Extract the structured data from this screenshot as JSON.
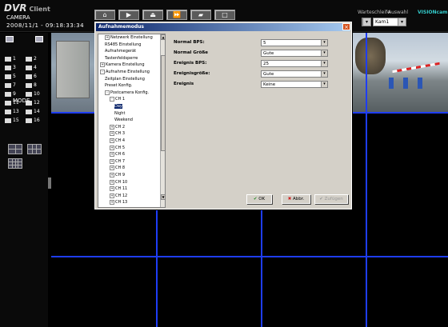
{
  "app": {
    "logo_main": "DVR",
    "logo_sub": "Client",
    "datetime": "2008/11/1 - 09:18:33:34"
  },
  "toolbar": {
    "buttons": [
      "⌂",
      "▶",
      "⏏",
      "⏩",
      "▰",
      "□"
    ]
  },
  "header": {
    "label1": "Warteschleife",
    "label2": "Auswahl",
    "brand": "VISIONcam",
    "select1": "",
    "select2": "Kam1"
  },
  "leftpanel": {
    "camera_label": "CAMERA",
    "mode_label": "MODE",
    "cameras": [
      "1",
      "2",
      "3",
      "4",
      "5",
      "6",
      "7",
      "8",
      "9",
      "10",
      "11",
      "12",
      "13",
      "14",
      "15",
      "16"
    ]
  },
  "dialog": {
    "title": "Aufnahmemodus",
    "close": "×",
    "tree": [
      {
        "label": "Netzwerk Einstellung",
        "level": 1,
        "pm": "+"
      },
      {
        "label": "RS485 Einstellung",
        "level": 1,
        "pm": ""
      },
      {
        "label": "Aufnahmegerät",
        "level": 1,
        "pm": ""
      },
      {
        "label": "Tastenfeldsperre",
        "level": 1,
        "pm": ""
      },
      {
        "label": "Kamera Einstellung",
        "level": 0,
        "pm": "+"
      },
      {
        "label": "Aufnahme Einstellung",
        "level": 0,
        "pm": "-"
      },
      {
        "label": "Zeitplan Einstellung",
        "level": 1,
        "pm": ""
      },
      {
        "label": "Preset Konfig.",
        "level": 1,
        "pm": ""
      },
      {
        "label": "Postcamera Konfig.",
        "level": 1,
        "pm": "-"
      },
      {
        "label": "CH 1",
        "level": 2,
        "pm": "-"
      },
      {
        "label": "Day",
        "level": 3,
        "pm": "",
        "selected": true
      },
      {
        "label": "Night",
        "level": 3,
        "pm": ""
      },
      {
        "label": "Weekend",
        "level": 3,
        "pm": ""
      },
      {
        "label": "CH 2",
        "level": 2,
        "pm": "+"
      },
      {
        "label": "CH 3",
        "level": 2,
        "pm": "+"
      },
      {
        "label": "CH 4",
        "level": 2,
        "pm": "+"
      },
      {
        "label": "CH 5",
        "level": 2,
        "pm": "+"
      },
      {
        "label": "CH 6",
        "level": 2,
        "pm": "+"
      },
      {
        "label": "CH 7",
        "level": 2,
        "pm": "+"
      },
      {
        "label": "CH 8",
        "level": 2,
        "pm": "+"
      },
      {
        "label": "CH 9",
        "level": 2,
        "pm": "+"
      },
      {
        "label": "CH 10",
        "level": 2,
        "pm": "+"
      },
      {
        "label": "CH 11",
        "level": 2,
        "pm": "+"
      },
      {
        "label": "CH 12",
        "level": 2,
        "pm": "+"
      },
      {
        "label": "CH 13",
        "level": 2,
        "pm": "+"
      }
    ],
    "fields": [
      {
        "label": "Normal BPS:",
        "value": "5"
      },
      {
        "label": "Normal Größe",
        "value": "Gute"
      },
      {
        "label": "Ereignis BPS:",
        "value": "25"
      },
      {
        "label": "Ereignisgröße:",
        "value": "Gute"
      },
      {
        "label": "Ereignis",
        "value": "Keine"
      }
    ],
    "ok": "OK",
    "cancel": "Abbr.",
    "apply": "Zufügen"
  }
}
